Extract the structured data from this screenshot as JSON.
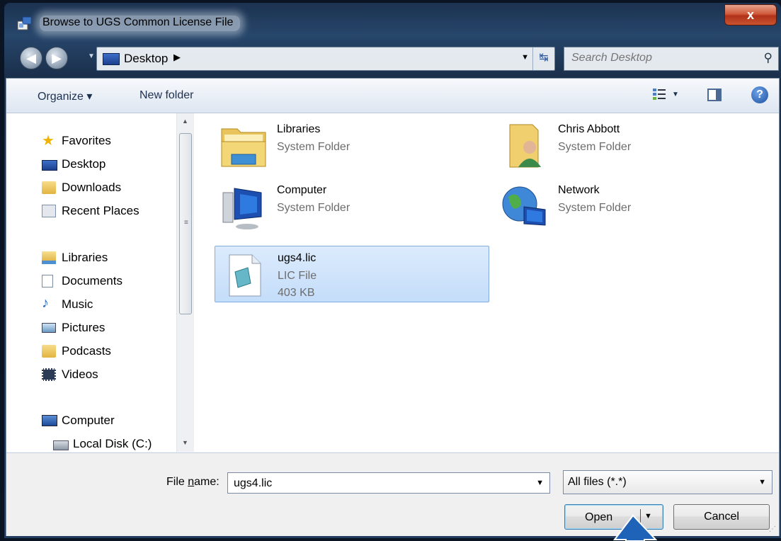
{
  "window": {
    "title": "Browse to UGS Common License File",
    "close_label": "x"
  },
  "address": {
    "location": "Desktop",
    "search_placeholder": "Search Desktop"
  },
  "toolbar": {
    "organize_label": "Organize ▾",
    "new_folder_label": "New folder"
  },
  "nav": {
    "favorites": {
      "label": "Favorites",
      "items": [
        {
          "label": "Desktop",
          "icon": "desktop-icon"
        },
        {
          "label": "Downloads",
          "icon": "downloads-folder-icon"
        },
        {
          "label": "Recent Places",
          "icon": "recent-places-icon"
        }
      ]
    },
    "libraries": {
      "label": "Libraries",
      "items": [
        {
          "label": "Documents",
          "icon": "documents-icon"
        },
        {
          "label": "Music",
          "icon": "music-icon"
        },
        {
          "label": "Pictures",
          "icon": "pictures-icon"
        },
        {
          "label": "Podcasts",
          "icon": "podcasts-folder-icon"
        },
        {
          "label": "Videos",
          "icon": "videos-icon"
        }
      ]
    },
    "computer": {
      "label": "Computer",
      "items": [
        {
          "label": "Local Disk (C:)",
          "icon": "local-disk-icon"
        }
      ]
    }
  },
  "files": [
    {
      "name": "Libraries",
      "type": "System Folder",
      "icon": "libraries-folder-icon"
    },
    {
      "name": "Chris Abbott",
      "type": "System Folder",
      "icon": "user-folder-icon"
    },
    {
      "name": "Computer",
      "type": "System Folder",
      "icon": "computer-icon"
    },
    {
      "name": "Network",
      "type": "System Folder",
      "icon": "network-icon"
    },
    {
      "name": "ugs4.lic",
      "type": "LIC File",
      "size": "403 KB",
      "icon": "file-icon",
      "selected": true
    }
  ],
  "footer": {
    "file_name_prefix": "File ",
    "file_name_accel": "n",
    "file_name_suffix": "ame:",
    "file_name_value": "ugs4.lic",
    "filter_value": "All files (*.*)",
    "open_label": "Open",
    "cancel_label": "Cancel"
  },
  "colors": {
    "selection": "#c4ddfa",
    "frame": "#223c5e",
    "close": "#c9542f"
  }
}
